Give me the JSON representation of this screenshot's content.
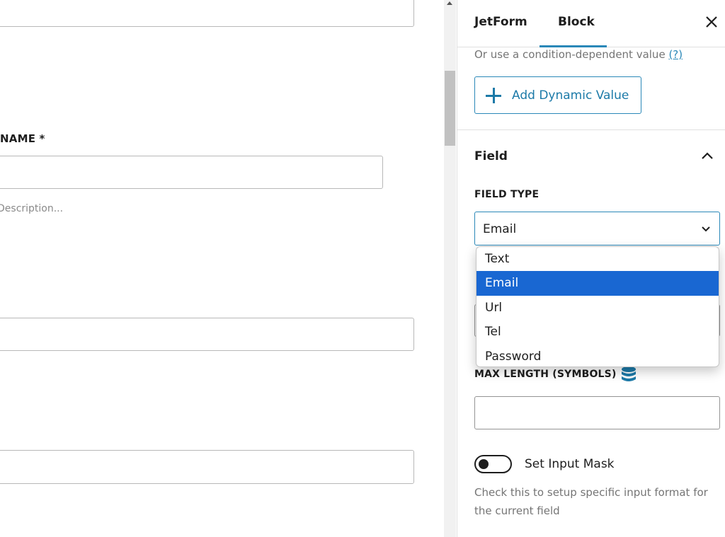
{
  "canvas": {
    "name_label": "NAME *",
    "description_placeholder": "Description..."
  },
  "sidebar": {
    "tabs": [
      {
        "label": "JetForm",
        "active": false
      },
      {
        "label": "Block",
        "active": true
      }
    ],
    "close_icon": "close-icon",
    "condition_text": "Or use a condition-dependent value",
    "help_link": "(?)",
    "add_dynamic_value": "Add Dynamic Value",
    "field_panel": {
      "title": "Field",
      "expanded": true,
      "field_type_label": "FIELD TYPE",
      "field_type_value": "Email",
      "field_type_options": [
        "Text",
        "Email",
        "Url",
        "Tel",
        "Password"
      ],
      "field_type_selected_index": 1,
      "max_length_label": "MAX LENGTH (SYMBOLS)",
      "max_length_value": "",
      "max_length_icon": "database-icon",
      "input_mask_label": "Set Input Mask",
      "input_mask_enabled": false,
      "input_mask_help": "Check this to setup specific input format for the current field"
    }
  },
  "colors": {
    "accent": "#2a88b8",
    "selected_option": "#1967d2",
    "muted_text": "#757575"
  }
}
